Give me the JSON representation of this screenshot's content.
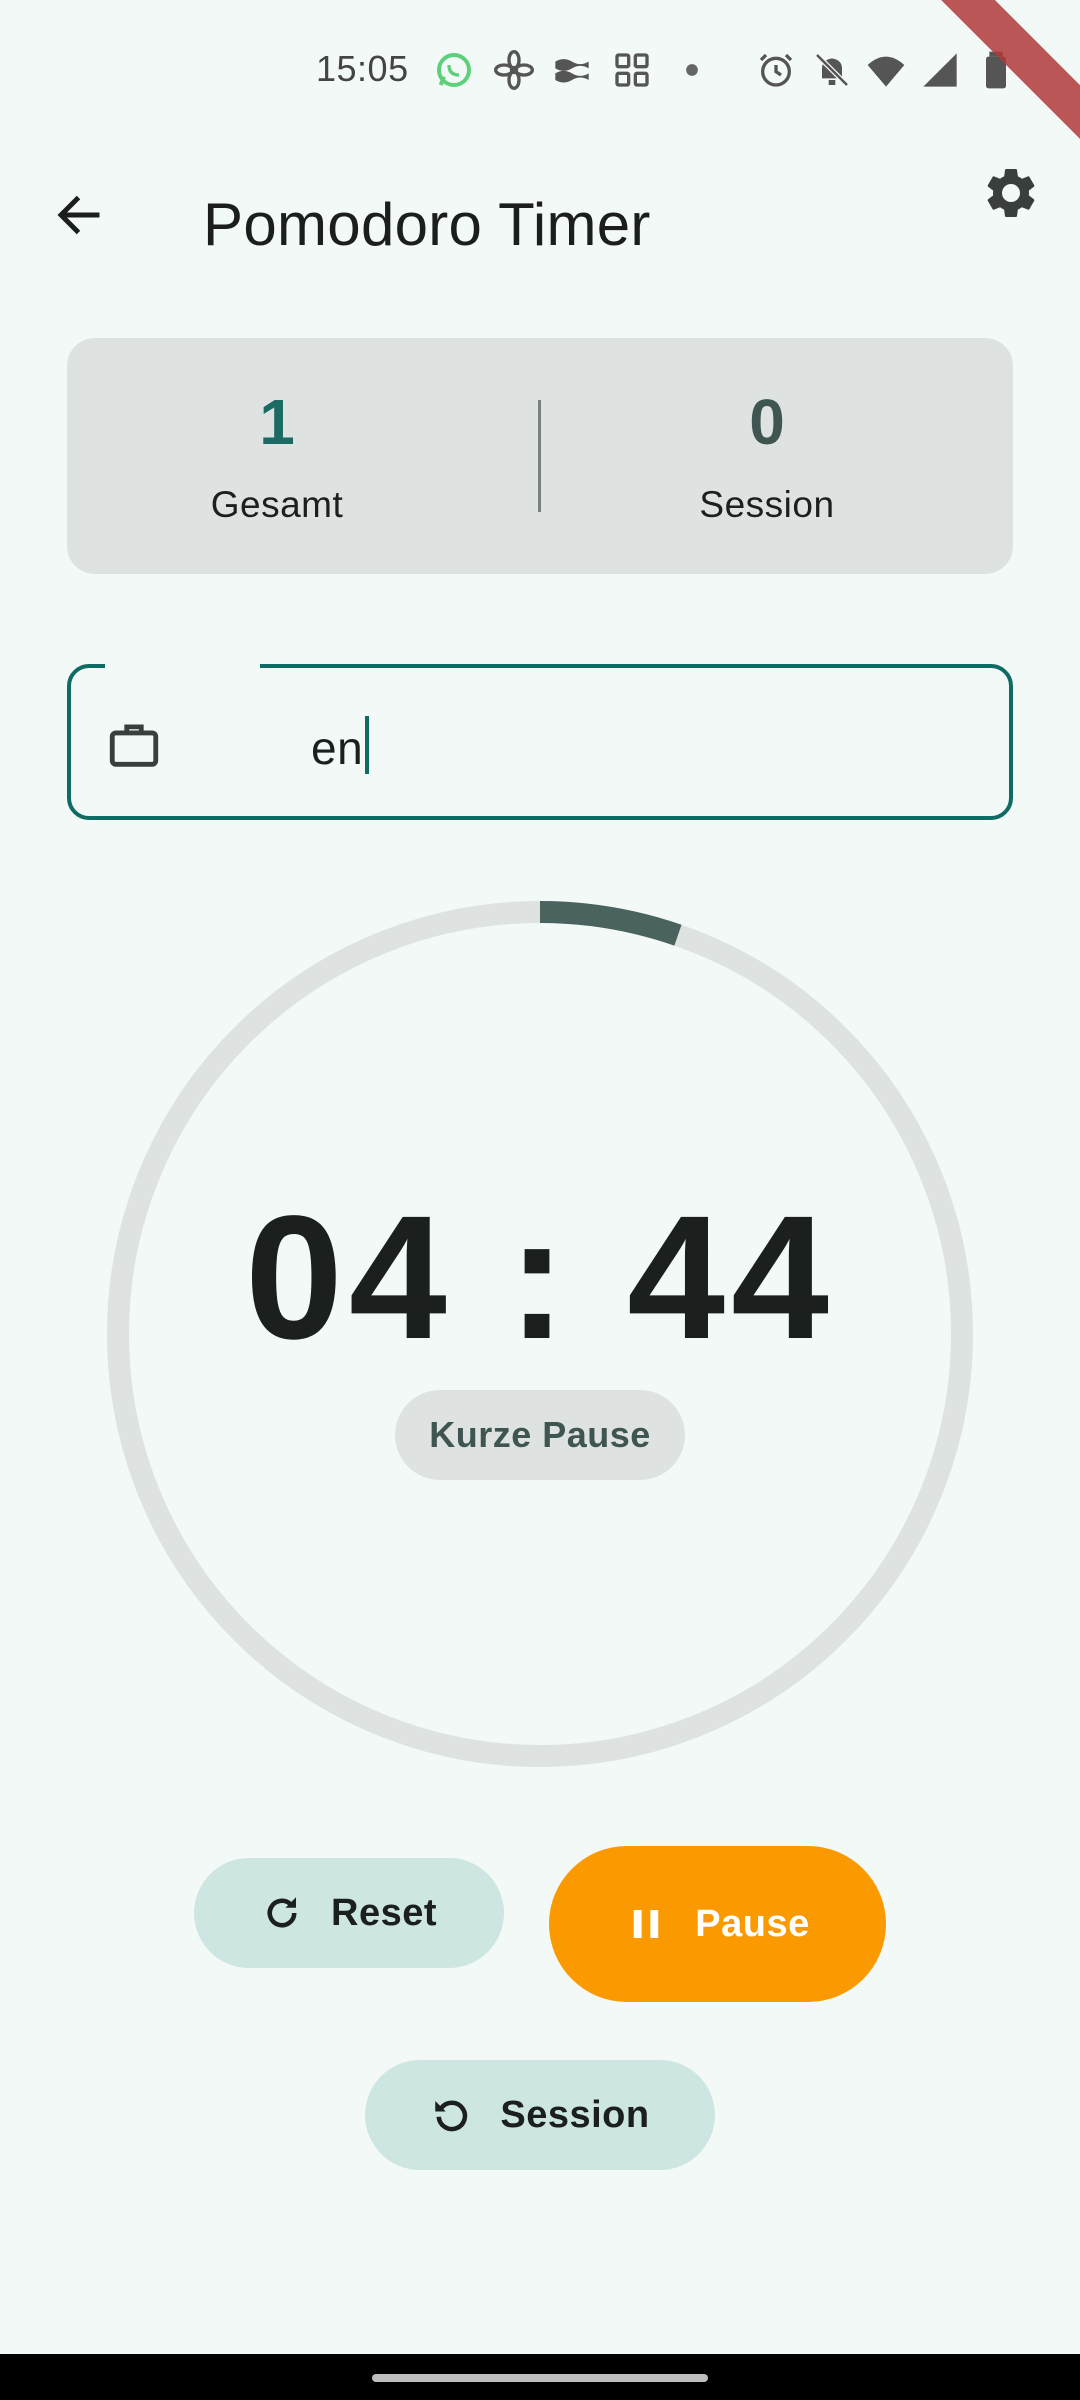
{
  "status_bar": {
    "time": "15:05",
    "icons": [
      "whatsapp-icon",
      "fan-icon",
      "wave-icon",
      "apps-icon",
      "dot-icon",
      "alarm-icon",
      "bell-off-icon",
      "wifi-icon",
      "signal-icon",
      "battery-icon"
    ]
  },
  "app_bar": {
    "title": "Pomodoro Timer",
    "back_icon": "arrow-back-icon",
    "settings_icon": "gear-icon"
  },
  "stats": {
    "total_value": "1",
    "total_label": "Gesamt",
    "session_value": "0",
    "session_label": "Session"
  },
  "project_field": {
    "icon": "briefcase-icon",
    "value": "en"
  },
  "timer": {
    "time": "04 : 44",
    "phase": "Kurze Pause",
    "progress": 0.053,
    "colors": {
      "track": "#dee3e1",
      "progress": "#4a635f"
    }
  },
  "controls": {
    "reset_label": "Reset",
    "pause_label": "Pause",
    "session_label": "Session"
  },
  "colors": {
    "background": "#f3f9f7",
    "primary": "#0f6b63",
    "accent": "#fb9900",
    "tonal": "#cde6e2"
  }
}
